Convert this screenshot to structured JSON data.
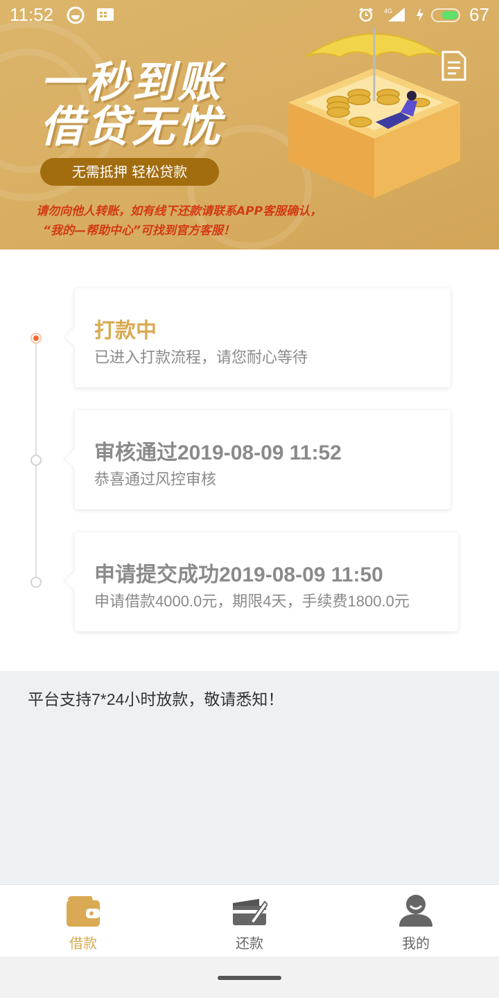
{
  "status_bar": {
    "time": "11:52",
    "battery": "67",
    "network": "4G"
  },
  "banner": {
    "slogan_line1": "一秒到账",
    "slogan_line2": "借贷无忧",
    "pill": "无需抵押  轻松贷款",
    "warning_line1": "请勿向他人转账，如有线下还款请联系APP客服确认，",
    "warning_line2": "“我的—帮助中心”可找到官方客服！"
  },
  "timeline": [
    {
      "title": "打款中",
      "subtitle": "已进入打款流程，请您耐心等待",
      "active": true
    },
    {
      "title": "审核通过2019-08-09 11:52",
      "subtitle": "恭喜通过风控审核",
      "active": false
    },
    {
      "title": "申请提交成功2019-08-09 11:50",
      "subtitle": "申请借款4000.0元，期限4天，手续费1800.0元",
      "active": false
    }
  ],
  "notice": {
    "text": "平台支持7*24小时放款，敬请悉知！"
  },
  "nav": {
    "items": [
      {
        "label": "借款",
        "icon": "wallet-icon",
        "active": true
      },
      {
        "label": "还款",
        "icon": "repay-icon",
        "active": false
      },
      {
        "label": "我的",
        "icon": "user-icon",
        "active": false
      }
    ]
  },
  "colors": {
    "accent": "#d9aa53",
    "banner": "#d8ae62",
    "active_dot": "#f36b2f",
    "warning": "#d23a14"
  }
}
